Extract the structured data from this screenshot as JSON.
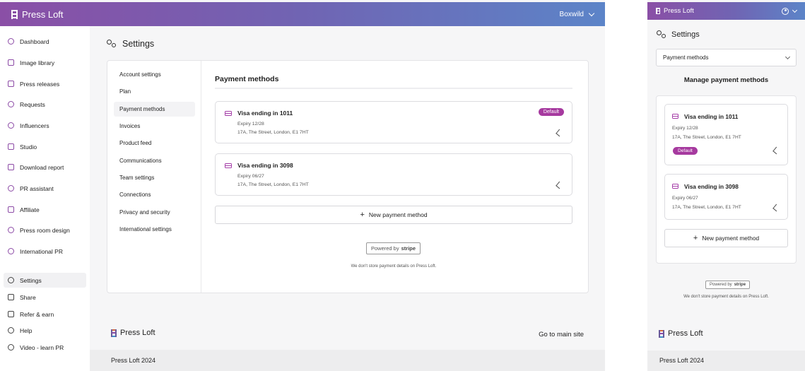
{
  "brand": "Press Loft",
  "account_name": "Boxwild",
  "sidebar": {
    "items": [
      {
        "label": "Dashboard",
        "icon": "dashboard-icon"
      },
      {
        "label": "Image library",
        "icon": "image-icon"
      },
      {
        "label": "Press releases",
        "icon": "document-icon"
      },
      {
        "label": "Requests",
        "icon": "chat-icon"
      },
      {
        "label": "Influencers",
        "icon": "influencer-icon"
      },
      {
        "label": "Studio",
        "icon": "studio-icon"
      },
      {
        "label": "Download report",
        "icon": "chart-icon"
      },
      {
        "label": "PR assistant",
        "icon": "sparkle-icon"
      },
      {
        "label": "Affiliate",
        "icon": "affiliate-icon"
      },
      {
        "label": "Press room design",
        "icon": "palette-icon"
      },
      {
        "label": "International PR",
        "icon": "globe-icon"
      }
    ],
    "bottom_items": [
      {
        "label": "Settings",
        "icon": "gear-icon"
      },
      {
        "label": "Share",
        "icon": "share-icon"
      },
      {
        "label": "Refer & earn",
        "icon": "gift-icon"
      },
      {
        "label": "Help",
        "icon": "info-icon"
      },
      {
        "label": "Video - learn PR",
        "icon": "play-icon"
      }
    ]
  },
  "page_title": "Settings",
  "settings_nav": [
    "Account settings",
    "Plan",
    "Payment methods",
    "Invoices",
    "Product feed",
    "Communications",
    "Team settings",
    "Connections",
    "Privacy and security",
    "International settings"
  ],
  "payment": {
    "section_title": "Payment methods",
    "cards": [
      {
        "title": "Visa ending in 1011",
        "expiry": "Expiry 12/28",
        "address": "17A, The Street, London, E1 7HT",
        "badge": "Default"
      },
      {
        "title": "Visa ending in 3098",
        "expiry": "Expiry 06/27",
        "address": "17A, The Street, London, E1 7HT"
      }
    ],
    "new_button": "New payment method",
    "powered_by": "Powered by",
    "stripe": "stripe",
    "note": "We don't store payment details on Press Loft."
  },
  "footer": {
    "link": "Go to main site",
    "copyright": "Press Loft 2024"
  },
  "mobile": {
    "select_value": "Payment methods",
    "title": "Manage payment methods",
    "cards": [
      {
        "title": "Visa ending in 1011",
        "expiry": "Expiry 12/28",
        "address": "17A, The Street, London, E1 7HT",
        "badge": "Default"
      },
      {
        "title": "Visa ending in 3098",
        "expiry": "Expiry 06/27",
        "address": "17A, The Street, London, E1 7HT"
      }
    ],
    "new_button": "New payment method"
  },
  "colors": {
    "accent": "#a63a9f",
    "header_start": "#8a4fa6",
    "header_end": "#5c84c8"
  }
}
